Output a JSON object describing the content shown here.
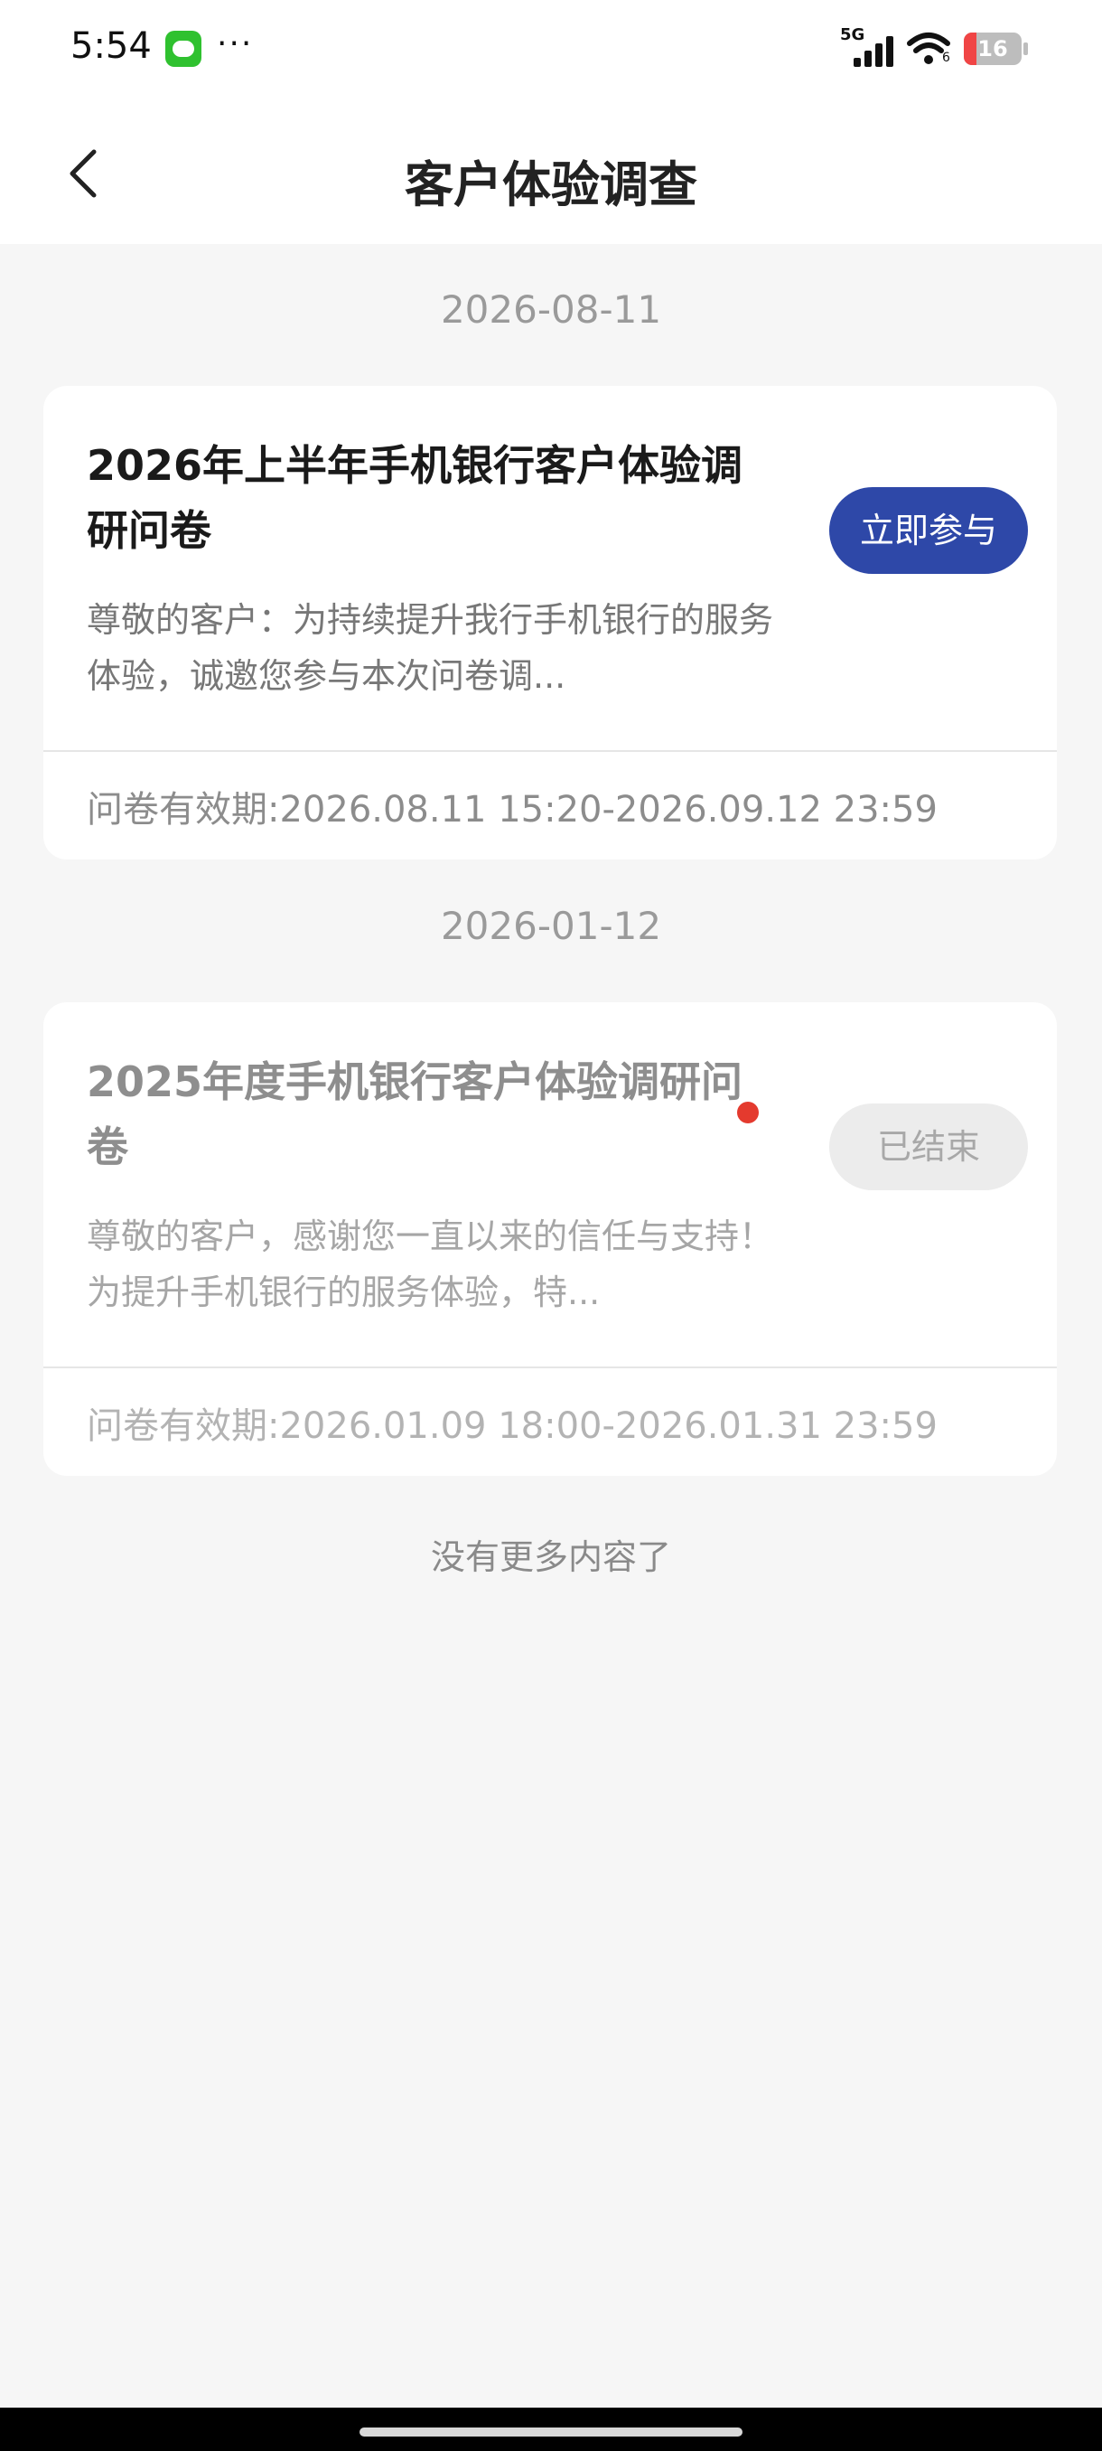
{
  "status_bar": {
    "time": "5:54",
    "more": "···",
    "network": "5G",
    "wifi_sub": "6",
    "battery": "16"
  },
  "header": {
    "title": "客户体验调查"
  },
  "surveys": [
    {
      "date": "2026-08-11",
      "title": "2026年上半年手机银行客户体验调研问卷",
      "description": "尊敬的客户：为持续提升我行手机银行的服务体验，诚邀您参与本次问卷调...",
      "period": "问卷有效期:2026.08.11 15:20-2026.09.12 23:59",
      "button": "立即参与",
      "status": "active"
    },
    {
      "date": "2026-01-12",
      "title": "2025年度手机银行客户体验调研问卷",
      "description": "尊敬的客户，感谢您一直以来的信任与支持！为提升手机银行的服务体验，特...",
      "period": "问卷有效期:2026.01.09 18:00-2026.01.31 23:59",
      "button": "已结束",
      "status": "ended"
    }
  ],
  "footer": {
    "no_more": "没有更多内容了"
  },
  "colors": {
    "primary_button": "#2e48a8",
    "unread_dot": "#e43a2e",
    "background": "#f6f6f6"
  }
}
